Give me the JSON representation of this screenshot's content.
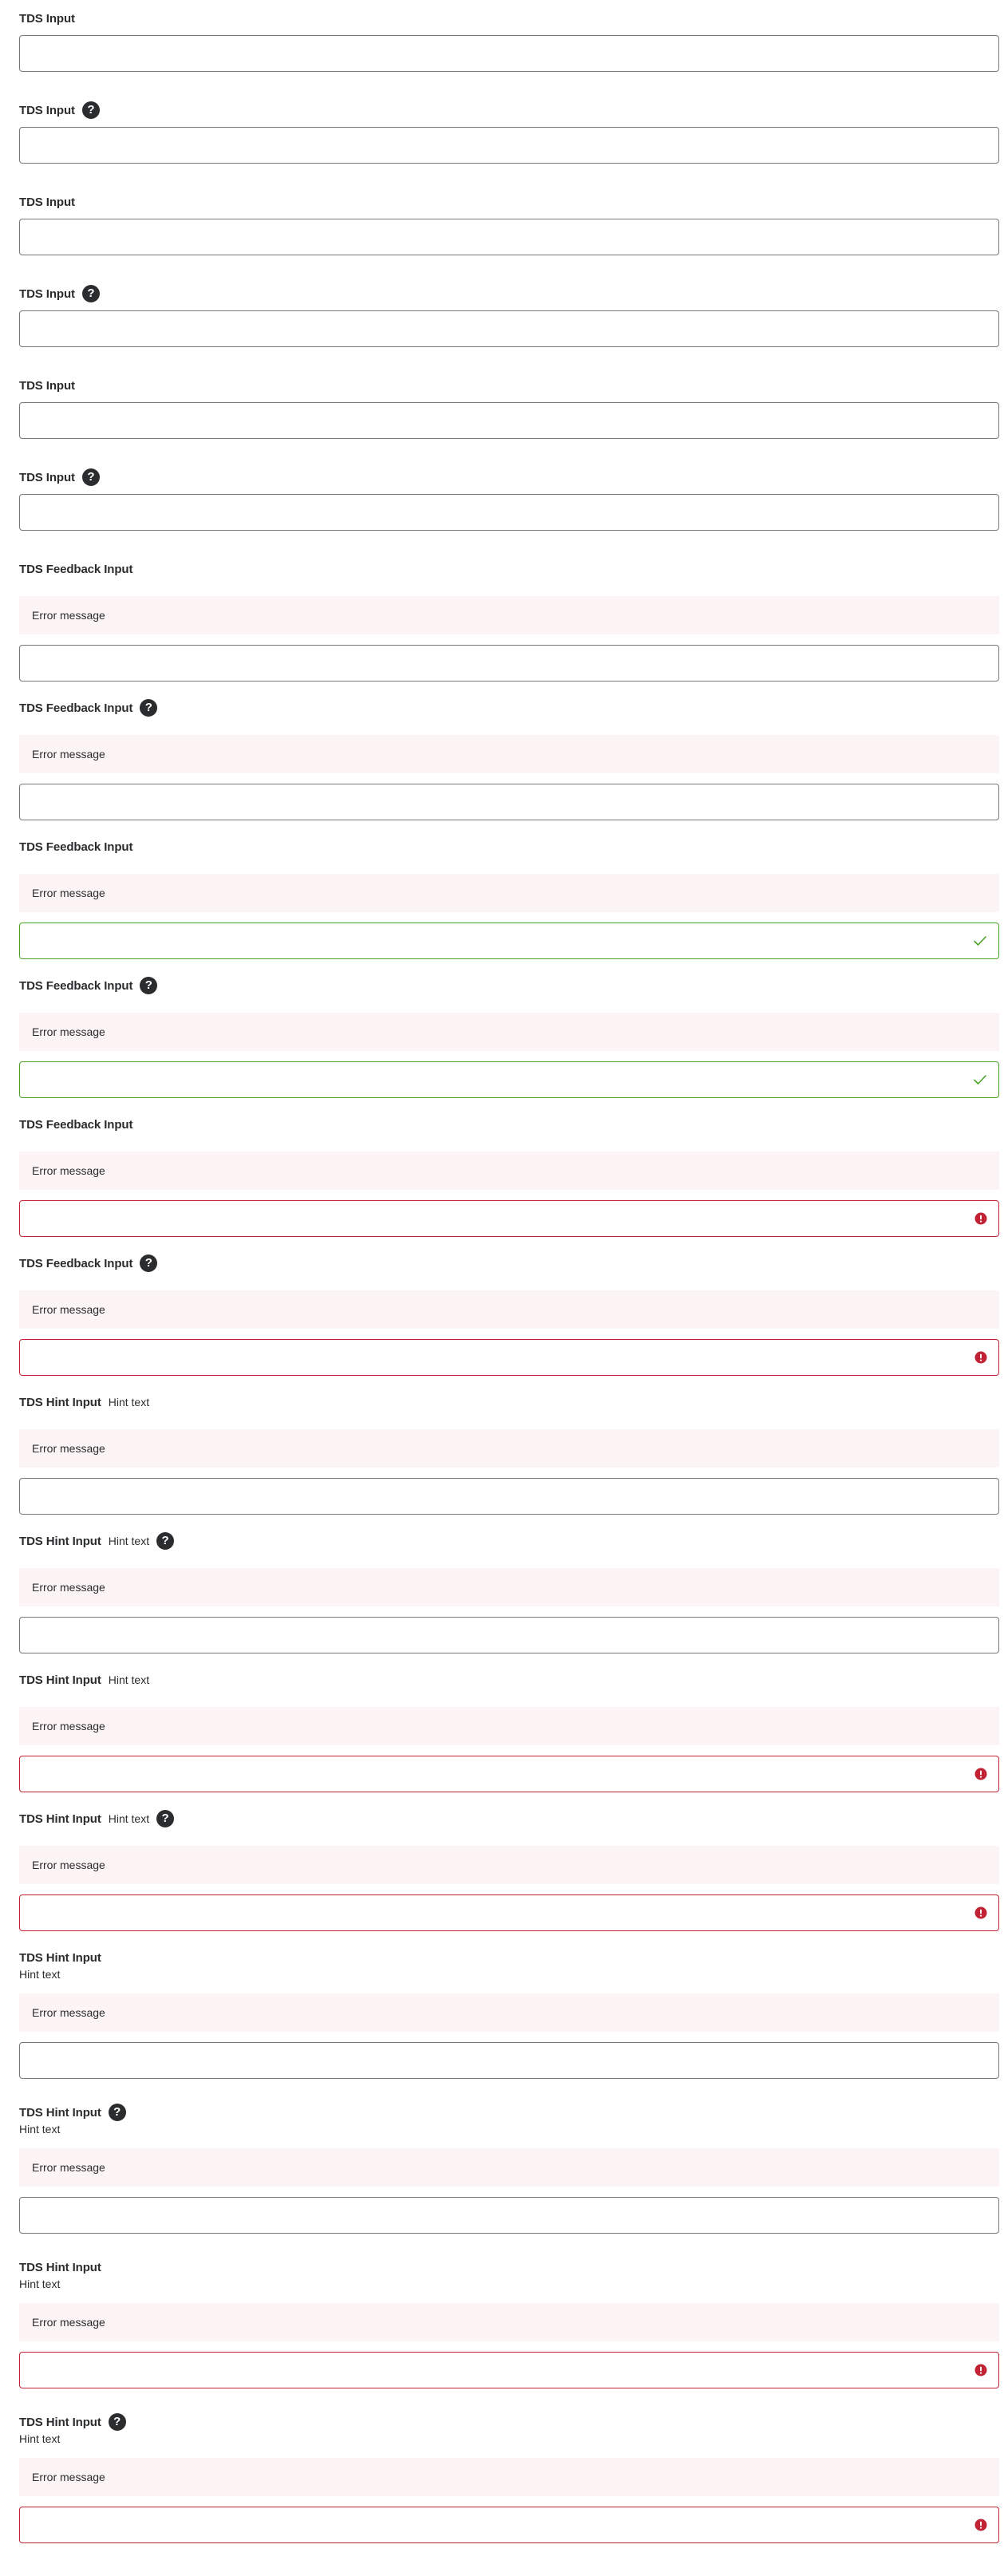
{
  "labels": {
    "input": "TDS Input",
    "feedback_input": "TDS Feedback Input",
    "hint_input": "TDS Hint Input"
  },
  "hint_text": "Hint text",
  "help_glyph": "?",
  "error_message": "Error message",
  "colors": {
    "text": "#2a2c2e",
    "border_default": "#747879",
    "border_success": "#4ca32a",
    "border_error": "#c12335",
    "feedback_background": "#fdf5f5"
  },
  "icons": {
    "help": "help-icon",
    "success": "checkmark-icon",
    "error": "error-icon"
  },
  "fields": [
    {
      "id": "input-1",
      "kind": "input",
      "help": false,
      "state": "default",
      "value": ""
    },
    {
      "id": "input-2",
      "kind": "input",
      "help": true,
      "state": "default",
      "value": ""
    },
    {
      "id": "input-3",
      "kind": "input",
      "help": false,
      "state": "default",
      "value": ""
    },
    {
      "id": "input-4",
      "kind": "input",
      "help": true,
      "state": "default",
      "value": ""
    },
    {
      "id": "input-5",
      "kind": "input",
      "help": false,
      "state": "default",
      "value": ""
    },
    {
      "id": "input-6",
      "kind": "input",
      "help": true,
      "state": "default",
      "value": ""
    },
    {
      "id": "feedback-1",
      "kind": "feedback",
      "help": false,
      "state": "default",
      "value": ""
    },
    {
      "id": "feedback-2",
      "kind": "feedback",
      "help": true,
      "state": "default",
      "value": ""
    },
    {
      "id": "feedback-3",
      "kind": "feedback",
      "help": false,
      "state": "success",
      "value": ""
    },
    {
      "id": "feedback-4",
      "kind": "feedback",
      "help": true,
      "state": "success",
      "value": ""
    },
    {
      "id": "feedback-5",
      "kind": "feedback",
      "help": false,
      "state": "error",
      "value": ""
    },
    {
      "id": "feedback-6",
      "kind": "feedback",
      "help": true,
      "state": "error",
      "value": ""
    },
    {
      "id": "hint-1",
      "kind": "hint-inline",
      "help": false,
      "state": "default",
      "value": ""
    },
    {
      "id": "hint-2",
      "kind": "hint-inline",
      "help": true,
      "state": "default",
      "value": ""
    },
    {
      "id": "hint-3",
      "kind": "hint-inline",
      "help": false,
      "state": "error",
      "value": ""
    },
    {
      "id": "hint-4",
      "kind": "hint-inline",
      "help": true,
      "state": "error",
      "value": ""
    },
    {
      "id": "hint-5",
      "kind": "hint-below",
      "help": false,
      "state": "default",
      "value": ""
    },
    {
      "id": "hint-6",
      "kind": "hint-below",
      "help": true,
      "state": "default",
      "value": ""
    },
    {
      "id": "hint-7",
      "kind": "hint-below",
      "help": false,
      "state": "error",
      "value": ""
    },
    {
      "id": "hint-8",
      "kind": "hint-below",
      "help": true,
      "state": "error",
      "value": ""
    }
  ]
}
